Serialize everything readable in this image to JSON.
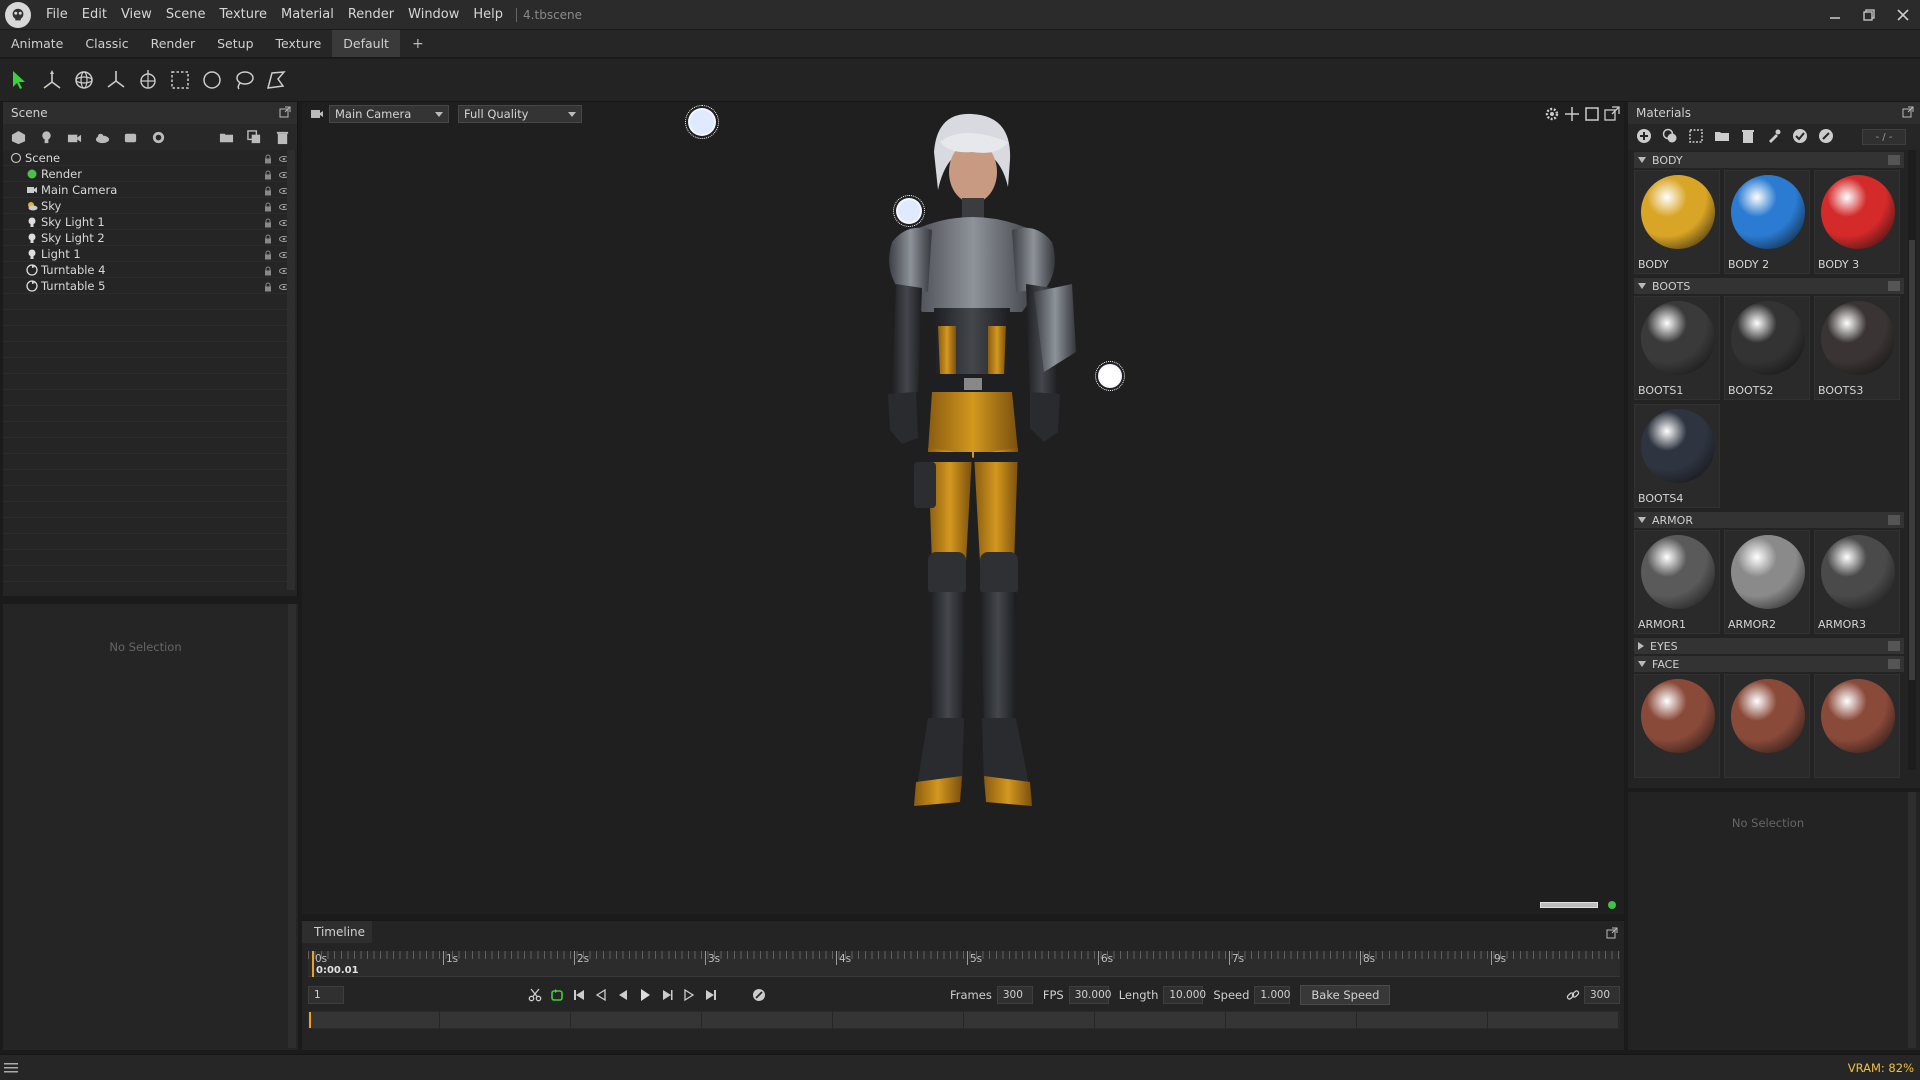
{
  "app": {
    "title": "4.tbscene",
    "menu": [
      "File",
      "Edit",
      "View",
      "Scene",
      "Texture",
      "Material",
      "Render",
      "Window",
      "Help"
    ]
  },
  "workspace_tabs": [
    {
      "label": "Animate",
      "active": false
    },
    {
      "label": "Classic",
      "active": false
    },
    {
      "label": "Render",
      "active": false
    },
    {
      "label": "Setup",
      "active": false
    },
    {
      "label": "Texture",
      "active": false
    },
    {
      "label": "Default",
      "active": true
    }
  ],
  "workspace_add": "+",
  "toolbar": {
    "tools": [
      "select-arrow-icon",
      "transform-gizmo-icon",
      "rotate-sphere-icon",
      "axis-icon",
      "mesh-icon",
      "rect-select-icon",
      "circle-select-icon",
      "lasso-select-icon",
      "polygon-select-icon"
    ]
  },
  "scene_panel": {
    "title": "Scene",
    "tree": [
      {
        "label": "Scene",
        "icon": "scene-icon",
        "depth": 0
      },
      {
        "label": "Render",
        "icon": "render-icon",
        "depth": 1
      },
      {
        "label": "Main Camera",
        "icon": "camera-icon",
        "depth": 1
      },
      {
        "label": "Sky",
        "icon": "sky-icon",
        "depth": 1
      },
      {
        "label": "Sky Light 1",
        "icon": "light-icon",
        "depth": 1
      },
      {
        "label": "Sky Light 2",
        "icon": "light-icon",
        "depth": 1
      },
      {
        "label": "Light 1",
        "icon": "light-icon",
        "depth": 1
      },
      {
        "label": "Turntable 4",
        "icon": "turntable-icon",
        "depth": 1
      },
      {
        "label": "Turntable 5",
        "icon": "turntable-icon",
        "depth": 1
      }
    ]
  },
  "props_panel": {
    "empty_text": "No Selection"
  },
  "viewport": {
    "camera": "Main Camera",
    "quality": "Full Quality"
  },
  "timeline": {
    "title": "Timeline",
    "ticks": [
      "0s",
      "1s",
      "2s",
      "3s",
      "4s",
      "5s",
      "6s",
      "7s",
      "8s",
      "9s"
    ],
    "current_time": "0:00.01",
    "current_frame": "1",
    "frames_label": "Frames",
    "frames": "300",
    "fps_label": "FPS",
    "fps": "30.000",
    "length_label": "Length",
    "length": "10.000",
    "speed_label": "Speed",
    "speed": "1.000",
    "bake_label": "Bake Speed",
    "end_frame": "300"
  },
  "materials": {
    "title": "Materials",
    "search_value": "- / -",
    "groups": [
      {
        "name": "BODY",
        "open": true,
        "items": [
          {
            "name": "BODY",
            "color": "#d9a526"
          },
          {
            "name": "BODY 2",
            "color": "#2a7bd1"
          },
          {
            "name": "BODY 3",
            "color": "#d42a2a"
          }
        ]
      },
      {
        "name": "BOOTS",
        "open": true,
        "items": [
          {
            "name": "BOOTS1",
            "color": "#3a3a3a"
          },
          {
            "name": "BOOTS2",
            "color": "#333333"
          },
          {
            "name": "BOOTS3",
            "color": "#3a3434"
          },
          {
            "name": "BOOTS4",
            "color": "#2e3440"
          }
        ]
      },
      {
        "name": "ARMOR",
        "open": true,
        "items": [
          {
            "name": "ARMOR1",
            "color": "#5a5a5a"
          },
          {
            "name": "ARMOR2",
            "color": "#8a8a8a"
          },
          {
            "name": "ARMOR3",
            "color": "#4a4a4a"
          }
        ]
      },
      {
        "name": "EYES",
        "open": false,
        "items": []
      },
      {
        "name": "FACE",
        "open": true,
        "items": [
          {
            "name": "",
            "color": "#8a4a3a"
          },
          {
            "name": "",
            "color": "#8a4a3a"
          },
          {
            "name": "",
            "color": "#8a4a3a"
          }
        ]
      }
    ]
  },
  "material_props": {
    "empty_text": "No Selection"
  },
  "status": {
    "vram": "VRAM: 82%"
  }
}
